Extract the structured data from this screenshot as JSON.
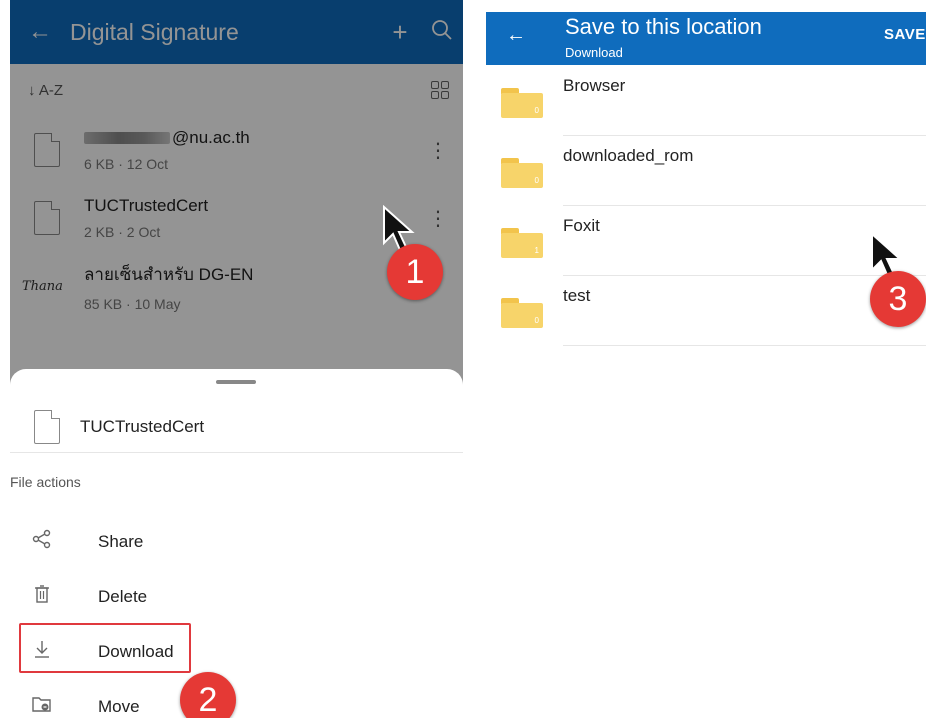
{
  "left_panel": {
    "appbar": {
      "back_glyph": "←",
      "title": "Digital Signature",
      "add_glyph": "+",
      "search_glyph": "⚲"
    },
    "sort": {
      "label": "↓ A-Z"
    },
    "files": [
      {
        "name_suffix": "@nu.ac.th",
        "meta": "6 KB · 12 Oct",
        "thumb": ""
      },
      {
        "name_suffix": "TUCTrustedCert",
        "meta": "2 KB · 2 Oct",
        "thumb": ""
      },
      {
        "name_suffix": "ลายเซ็นสำหรับ DG-EN",
        "meta": "85 KB · 10 May",
        "thumb": "Thana"
      }
    ],
    "sheet": {
      "file_name": "TUCTrustedCert",
      "section_label": "File actions",
      "actions": [
        {
          "label": "Share",
          "icon": "share-icon",
          "glyph": "ᐸ"
        },
        {
          "label": "Delete",
          "icon": "trash-icon",
          "glyph": "🗑"
        },
        {
          "label": "Download",
          "icon": "download-icon",
          "glyph": "↓"
        },
        {
          "label": "Move",
          "icon": "move-folder-icon",
          "glyph": "⇒"
        }
      ]
    }
  },
  "right_panel": {
    "appbar": {
      "back_glyph": "←",
      "title": "Save to this location",
      "subtitle": "Download",
      "save_label": "SAVE"
    },
    "folders": [
      {
        "name": "Browser",
        "count": "0"
      },
      {
        "name": "downloaded_rom",
        "count": "0"
      },
      {
        "name": "Foxit",
        "count": "1"
      },
      {
        "name": "test",
        "count": "0"
      }
    ]
  },
  "annotations": {
    "steps": [
      "1",
      "2",
      "3"
    ],
    "step_color": "#e53935"
  },
  "colors": {
    "accent": "#0f6cbd",
    "highlight_border": "#e0393e",
    "folder": "#f7d46a"
  }
}
